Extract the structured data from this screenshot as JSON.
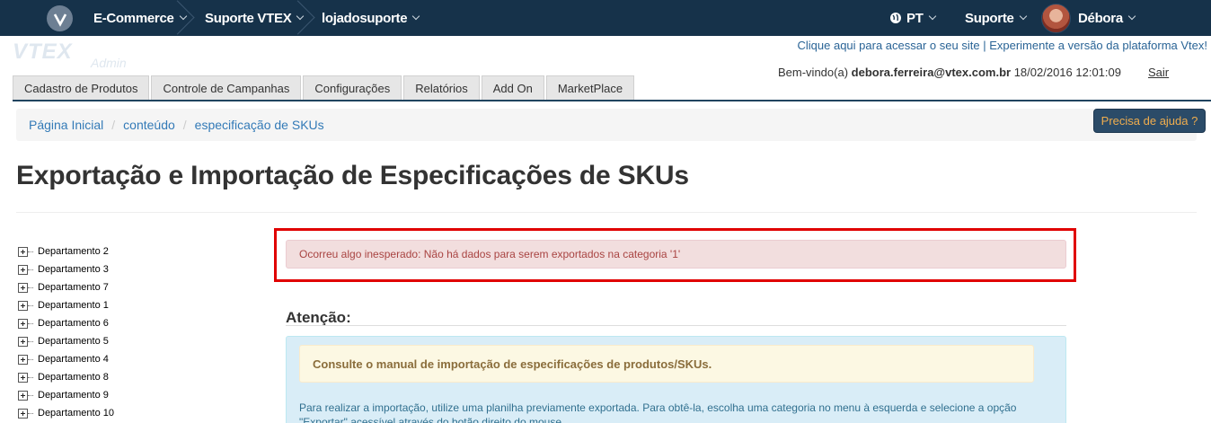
{
  "topnav": {
    "store": "E-Commerce",
    "support_account": "Suporte VTEX",
    "store_account": "lojadosuporte",
    "language": "PT",
    "support": "Suporte",
    "user": "Débora"
  },
  "header": {
    "logo_text": "VTEX",
    "logo_sub": "Admin",
    "link_site": "Clique aqui para acessar o seu site",
    "link_separator": "|",
    "link_platform": "Experimente a versão da plataforma Vtex!",
    "welcome_prefix": "Bem-vindo(a)",
    "welcome_email": "debora.ferreira@vtex.com.br",
    "welcome_datetime": "18/02/2016 12:01:09",
    "logout": "Sair"
  },
  "tabs": [
    "Cadastro de Produtos",
    "Controle de Campanhas",
    "Configurações",
    "Relatórios",
    "Add On",
    "MarketPlace"
  ],
  "breadcrumb": [
    "Página Inicial",
    "conteúdo",
    "especificação de SKUs"
  ],
  "breadcrumb_divider": "/",
  "help_button": "Precisa de ajuda ?",
  "page_title": "Exportação e Importação de Especificações de SKUs",
  "tree": [
    "Departamento 2",
    "Departamento 3",
    "Departamento 7",
    "Departamento 1",
    "Departamento 6",
    "Departamento 5",
    "Departamento 4",
    "Departamento 8",
    "Departamento 9",
    "Departamento 10"
  ],
  "error_message": "Ocorreu algo inesperado: Não há dados para serem exportados na categoria '1'",
  "attention_heading": "Atenção:",
  "warning_text": "Consulte o manual de importação de especificações de produtos/SKUs.",
  "info_text": "Para realizar a importação, utilize uma planilha previamente exportada. Para obtê-la, escolha uma categoria no menu à esquerda e selecione a opção \"Exportar\" acessível através do botão direito do mouse."
}
